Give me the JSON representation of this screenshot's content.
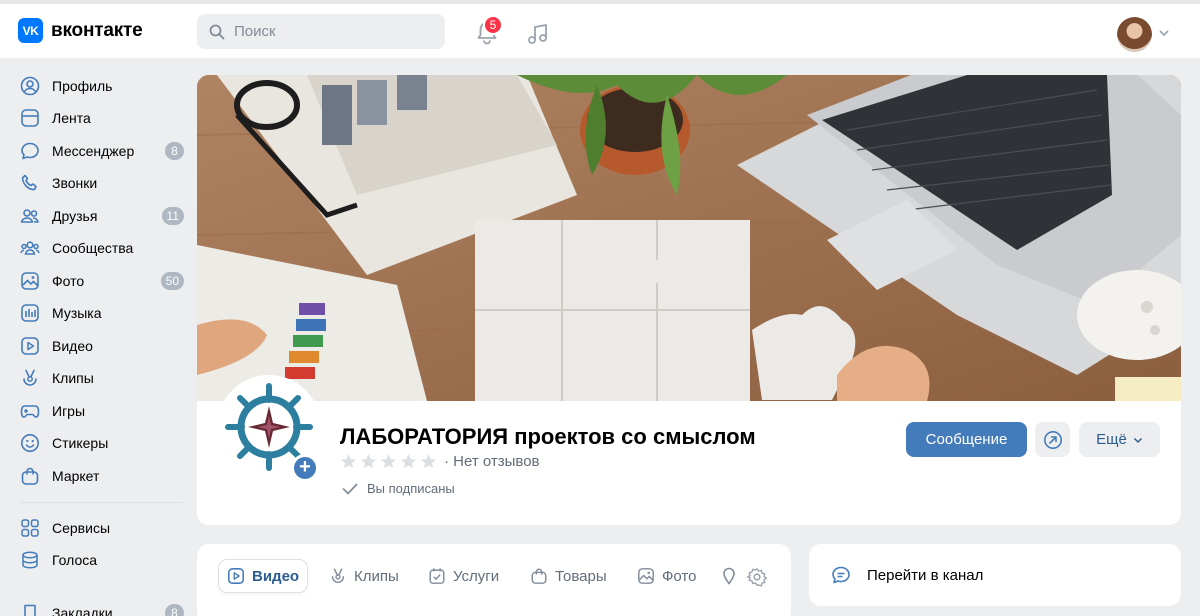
{
  "header": {
    "brand": "вконтакте",
    "logo_text": "VK",
    "search_placeholder": "Поиск",
    "notifications_count": "5"
  },
  "sidebar": {
    "items": [
      {
        "label": "Профиль",
        "icon": "profile-icon",
        "count": ""
      },
      {
        "label": "Лента",
        "icon": "feed-icon",
        "count": ""
      },
      {
        "label": "Мессенджер",
        "icon": "messenger-icon",
        "count": "8"
      },
      {
        "label": "Звонки",
        "icon": "phone-icon",
        "count": ""
      },
      {
        "label": "Друзья",
        "icon": "friends-icon",
        "count": "11"
      },
      {
        "label": "Сообщества",
        "icon": "communities-icon",
        "count": ""
      },
      {
        "label": "Фото",
        "icon": "photo-icon",
        "count": "50"
      },
      {
        "label": "Музыка",
        "icon": "music-icon",
        "count": ""
      },
      {
        "label": "Видео",
        "icon": "video-icon",
        "count": ""
      },
      {
        "label": "Клипы",
        "icon": "clips-icon",
        "count": ""
      },
      {
        "label": "Игры",
        "icon": "games-icon",
        "count": ""
      },
      {
        "label": "Стикеры",
        "icon": "stickers-icon",
        "count": ""
      },
      {
        "label": "Маркет",
        "icon": "market-icon",
        "count": ""
      },
      {
        "label": "Сервисы",
        "icon": "services-icon",
        "count": ""
      },
      {
        "label": "Голоса",
        "icon": "votes-icon",
        "count": ""
      },
      {
        "label": "Закладки",
        "icon": "bookmarks-icon",
        "count": "8"
      }
    ]
  },
  "group": {
    "name": "ЛАБОРАТОРИЯ проектов со смыслом",
    "reviews": "· Нет отзывов",
    "subscribed": "Вы подписаны",
    "message_button": "Сообщение",
    "more_button": "Ещё"
  },
  "tabs": [
    {
      "label": "Видео",
      "icon": "video-icon"
    },
    {
      "label": "Клипы",
      "icon": "clips-icon"
    },
    {
      "label": "Услуги",
      "icon": "services-check-icon"
    },
    {
      "label": "Товары",
      "icon": "bag-icon"
    },
    {
      "label": "Фото",
      "icon": "photo-icon"
    }
  ],
  "channel": {
    "label": "Перейти в канал"
  },
  "colors": {
    "accent": "#447bba",
    "brand": "#0077ff",
    "badge": "#ff3347"
  }
}
